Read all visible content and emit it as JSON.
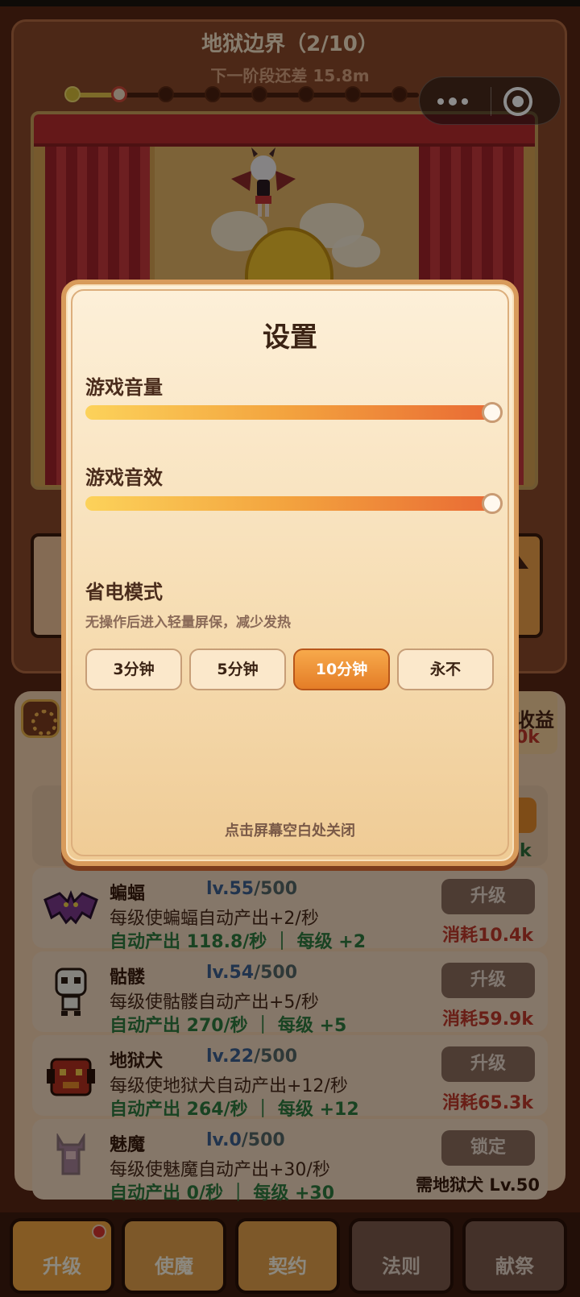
{
  "stage": {
    "title": "地狱边界（2/10）",
    "next_stage": "下一阶段还差 15.8m",
    "progress_current": 2,
    "progress_total": 10
  },
  "side": {
    "income_label": "收益",
    "income_value": "0k",
    "partial_value": "k"
  },
  "units": [
    {
      "name": "蝙蝠",
      "lv": "lv.55",
      "max": "/500",
      "desc": "每级使蝙蝠自动产出+2/秒",
      "prod": "自动产出 118.8/秒 ｜ 每级 +2",
      "button": "升级",
      "cost": "消耗10.4k"
    },
    {
      "name": "骷髅",
      "lv": "lv.54",
      "max": "/500",
      "desc": "每级使骷髅自动产出+5/秒",
      "prod": "自动产出 270/秒 ｜ 每级 +5",
      "button": "升级",
      "cost": "消耗59.9k"
    },
    {
      "name": "地狱犬",
      "lv": "lv.22",
      "max": "/500",
      "desc": "每级使地狱犬自动产出+12/秒",
      "prod": "自动产出 264/秒 ｜ 每级 +12",
      "button": "升级",
      "cost": "消耗65.3k"
    },
    {
      "name": "魅魔",
      "lv": "lv.0",
      "max": "/500",
      "desc": "每级使魅魔自动产出+30/秒",
      "prod": "自动产出 0/秒 ｜ 每级 +30",
      "button": "锁定",
      "requirement": "需地狱犬 Lv.50"
    }
  ],
  "nav": [
    {
      "label": "升级",
      "state": "active"
    },
    {
      "label": "使魔",
      "state": "normal"
    },
    {
      "label": "契约",
      "state": "normal"
    },
    {
      "label": "法则",
      "state": "locked"
    },
    {
      "label": "献祭",
      "state": "locked"
    }
  ],
  "settings": {
    "title": "设置",
    "music_label": "游戏音量",
    "music_level": 1.0,
    "sfx_label": "游戏音效",
    "sfx_level": 1.0,
    "power_label": "省电模式",
    "power_desc": "无操作后进入轻量屏保，减少发热",
    "power_options": [
      "3分钟",
      "5分钟",
      "10分钟",
      "永不"
    ],
    "power_selected": "10分钟",
    "close_hint": "点击屏幕空白处关闭"
  },
  "colors": {
    "accent": "#e47d27",
    "cost_red": "#c0392b",
    "prod_green": "#2f7a3f"
  }
}
